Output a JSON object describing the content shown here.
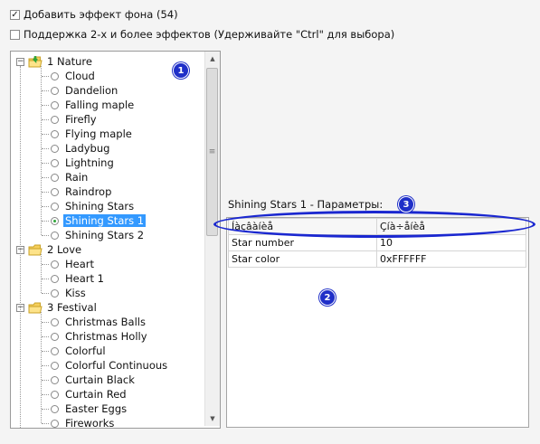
{
  "checkboxes": {
    "add_background": {
      "label": "Добавить эффект фона (54)",
      "checked": true
    },
    "multi_effects": {
      "label": "Поддержка 2-х и более эффектов (Удерживайте \"Ctrl\" для выбора)",
      "checked": false
    }
  },
  "tree": {
    "groups": [
      {
        "label": "1 Nature",
        "items": [
          "Cloud",
          "Dandelion",
          "Falling maple",
          "Firefly",
          "Flying maple",
          "Ladybug",
          "Lightning",
          "Rain",
          "Raindrop",
          "Shining Stars",
          "Shining Stars 1",
          "Shining Stars 2"
        ]
      },
      {
        "label": "2 Love",
        "items": [
          "Heart",
          "Heart 1",
          "Kiss"
        ]
      },
      {
        "label": "3 Festival",
        "items": [
          "Christmas Balls",
          "Christmas Holly",
          "Colorful",
          "Colorful Continuous",
          "Curtain Black",
          "Curtain Red",
          "Easter Eggs",
          "Fireworks"
        ]
      }
    ],
    "selected_item": "Shining Stars 1"
  },
  "params": {
    "title": "Shining Stars 1 - Параметры:",
    "header": [
      "Íàçâàíèå",
      "Çíà÷åíèå"
    ],
    "rows": [
      [
        "Star number",
        "10"
      ],
      [
        "Star color",
        "0xFFFFFF"
      ]
    ]
  },
  "annotations": [
    "1",
    "2",
    "3"
  ],
  "colors": {
    "annotation": "#1f2fc8",
    "selection": "#3399ff"
  }
}
